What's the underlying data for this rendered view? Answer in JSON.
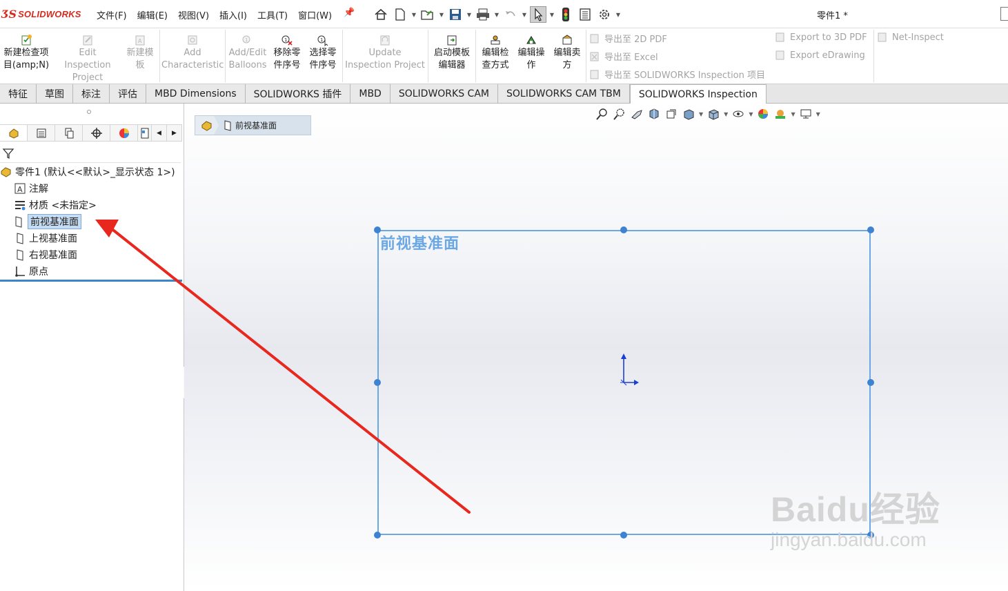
{
  "app": {
    "brand": "SOLIDWORKS",
    "brand_color": "#d52b1e",
    "document_title": "零件1 *"
  },
  "menu": [
    "文件(F)",
    "编辑(E)",
    "视图(V)",
    "插入(I)",
    "工具(T)",
    "窗口(W)"
  ],
  "quick_toolbar": [
    "home-icon",
    "new-document-icon",
    "open-icon",
    "save-icon",
    "print-icon",
    "undo-icon",
    "select-arrow-icon",
    "traffic-light-icon",
    "file-properties-icon",
    "options-gear-icon"
  ],
  "commands": {
    "new_project": "新建检查项目(amp;N)",
    "edit_project": "Edit Inspection Project",
    "new_template": "新建模板",
    "add_characteristic": "Add Characteristic",
    "add_edit_balloons": "Add/Edit Balloons",
    "remove_part_number": "移除零件序号",
    "select_part_number": "选择零件序号",
    "update_project": "Update Inspection Project",
    "start_template_editor": "启动模板编辑器",
    "edit_inspection_method": "编辑检查方式",
    "edit_operation": "编辑操作",
    "edit_vendor": "编辑卖方",
    "export_2d_pdf": "导出至 2D PDF",
    "export_excel": "导出至 Excel",
    "export_sw_project": "导出至 SOLIDWORKS Inspection 项目",
    "export_3d_pdf": "Export to 3D PDF",
    "export_edrawing": "Export eDrawing",
    "net_inspect": "Net-Inspect"
  },
  "tabs": [
    "特征",
    "草图",
    "标注",
    "评估",
    "MBD Dimensions",
    "SOLIDWORKS 插件",
    "MBD",
    "SOLIDWORKS CAM",
    "SOLIDWORKS CAM TBM",
    "SOLIDWORKS Inspection"
  ],
  "active_tab": "SOLIDWORKS Inspection",
  "tree": {
    "root": "零件1  (默认<<默认>_显示状态 1>)",
    "items": [
      "注解",
      "材质 <未指定>",
      "前视基准面",
      "上视基准面",
      "右视基准面",
      "原点"
    ],
    "selected": "前视基准面"
  },
  "breadcrumb": {
    "label": "前视基准面"
  },
  "viewport": {
    "plane_label": "前视基准面",
    "plane_color": "#6aa7e3",
    "handle_color": "#3d83d1"
  },
  "watermark": {
    "main": "Baidu经验",
    "sub": "jingyan.baidu.com"
  }
}
